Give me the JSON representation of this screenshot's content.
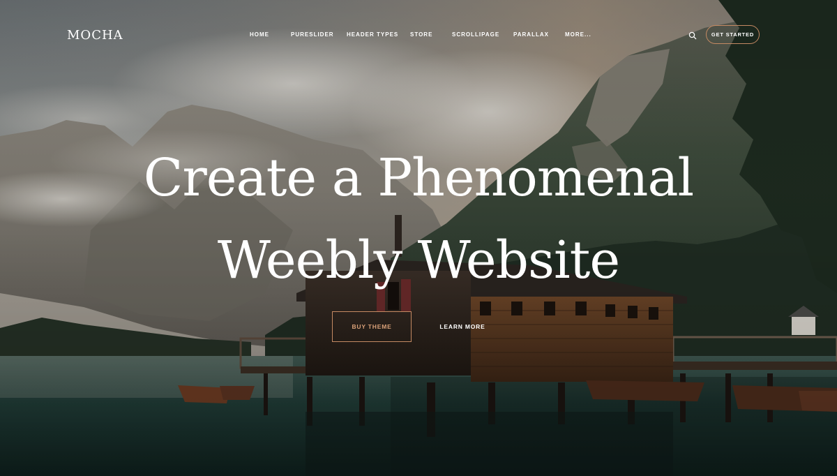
{
  "header": {
    "logo": "MOCHA",
    "nav": [
      {
        "label": "HOME"
      },
      {
        "label": "PURESLIDER"
      },
      {
        "label": "HEADER TYPES"
      },
      {
        "label": "STORE"
      },
      {
        "label": "SCROLLIPAGE"
      },
      {
        "label": "PARALLAX"
      },
      {
        "label": "MORE..."
      }
    ],
    "search_icon": "search-icon",
    "cta_label": "GET STARTED"
  },
  "hero": {
    "headline_line1": "Create a Phenomenal",
    "headline_line2": "Weebly Website",
    "buy_label": "BUY THEME",
    "learn_label": "LEARN MORE"
  },
  "colors": {
    "accent": "#c58a63",
    "text": "#ffffff"
  }
}
